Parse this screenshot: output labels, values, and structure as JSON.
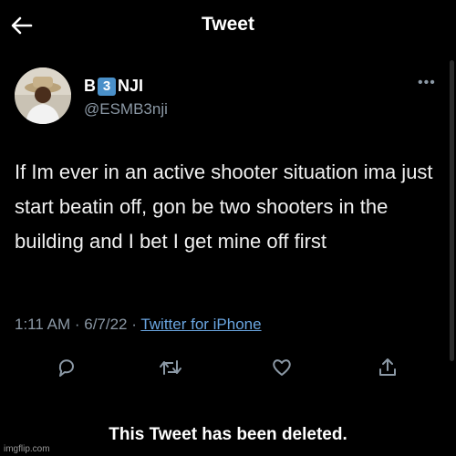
{
  "header": {
    "title": "Tweet",
    "back_icon": "back-arrow-icon"
  },
  "author": {
    "name_prefix": "B",
    "name_badge": "3",
    "name_suffix": "NJI",
    "handle": "@ESMB3nji",
    "more_label": "•••"
  },
  "tweet": {
    "text": "If Im ever in an active shooter situation ima just start beatin off, gon be two shooters in the building and I bet I get mine off first",
    "time": "1:11 AM",
    "sep1": " · ",
    "date": "6/7/22",
    "sep2": " · ",
    "source": "Twitter for iPhone"
  },
  "actions": [
    "reply-icon",
    "retweet-icon",
    "like-icon",
    "share-icon"
  ],
  "status": {
    "deleted_text": "This Tweet has been deleted."
  },
  "watermark": "imgflip.com",
  "colors": {
    "background": "#000000",
    "link": "#6aa5e0",
    "secondary": "#8b98a5",
    "badge": "#4a90c9"
  }
}
